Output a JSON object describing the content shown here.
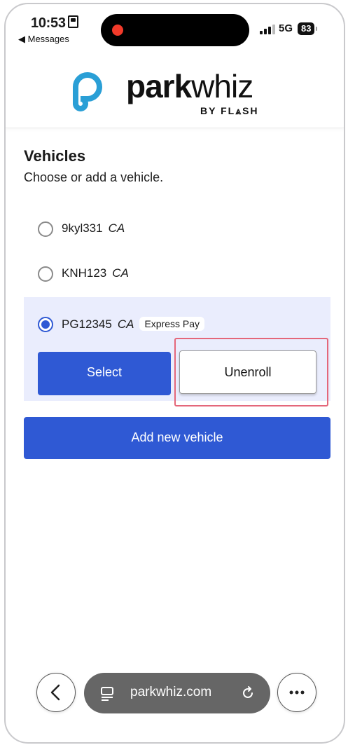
{
  "status_bar": {
    "time": "10:53",
    "back_label": "◀ Messages",
    "network": "5G",
    "battery": "83"
  },
  "header": {
    "brand_bold": "park",
    "brand_light": "whiz",
    "byline": "BY FL⩓SH",
    "brand_color": "#2a9fd6"
  },
  "page": {
    "title": "Vehicles",
    "subtitle": "Choose or add a vehicle."
  },
  "vehicles": [
    {
      "plate": "9kyl331",
      "state": "CA",
      "selected": false
    },
    {
      "plate": "KNH123",
      "state": "CA",
      "selected": false
    },
    {
      "plate": "PG12345",
      "state": "CA",
      "badge": "Express Pay",
      "selected": true
    }
  ],
  "actions": {
    "select_label": "Select",
    "unenroll_label": "Unenroll",
    "add_label": "Add new vehicle",
    "primary_color": "#2f59d4"
  },
  "browser": {
    "url": "parkwhiz.com",
    "back_icon": "chevron-left-icon",
    "more_icon": "ellipsis-icon"
  }
}
